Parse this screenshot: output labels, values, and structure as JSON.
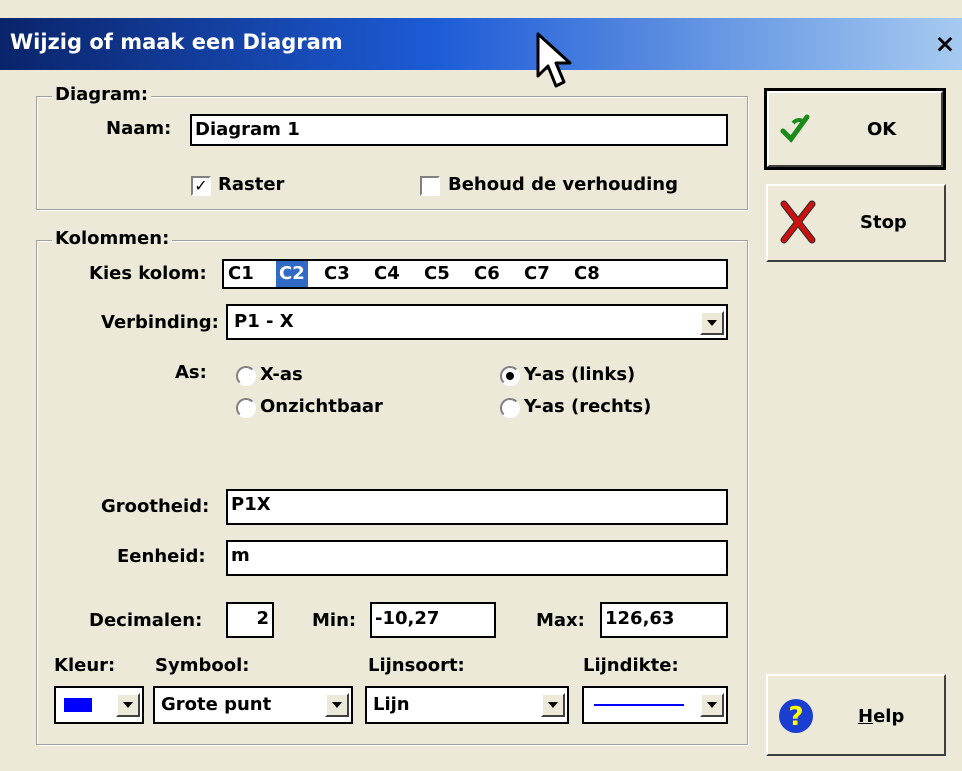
{
  "window": {
    "title": "Wijzig of maak een Diagram",
    "close_icon": "×"
  },
  "diagram_group": {
    "legend": "Diagram:",
    "name_label": "Naam:",
    "name_value": "Diagram 1",
    "raster_label": "Raster",
    "raster_checked": true,
    "aspect_label": "Behoud de verhouding",
    "aspect_checked": false
  },
  "columns_group": {
    "legend": "Kolommen:",
    "choose_label": "Kies kolom:",
    "columns": [
      "C1",
      "C2",
      "C3",
      "C4",
      "C5",
      "C6",
      "C7",
      "C8"
    ],
    "selected_column": "C2",
    "connection_label": "Verbinding:",
    "connection_value": "P1 - X",
    "axis_label": "As:",
    "axis_options": {
      "x": "X-as",
      "invisible": "Onzichtbaar",
      "y_left": "Y-as (links)",
      "y_right": "Y-as (rechts)"
    },
    "axis_selected": "Y-as (links)",
    "quantity_label": "Grootheid:",
    "quantity_value": "P1X",
    "unit_label": "Eenheid:",
    "unit_value": "m",
    "decimals_label": "Decimalen:",
    "decimals_value": "2",
    "min_label": "Min:",
    "min_value": "-10,27",
    "max_label": "Max:",
    "max_value": "126,63",
    "color_label": "Kleur:",
    "color_value": "#0000ff",
    "symbol_label": "Symbool:",
    "symbol_value": "Grote punt",
    "linetype_label": "Lijnsoort:",
    "linetype_value": "Lijn",
    "linewidth_label": "Lijndikte:"
  },
  "buttons": {
    "ok": "OK",
    "stop": "Stop",
    "help_first": "H",
    "help_rest": "elp"
  },
  "icons": {
    "ok": "ok-check-icon",
    "stop": "stop-x-icon",
    "help": "help-question-icon"
  }
}
